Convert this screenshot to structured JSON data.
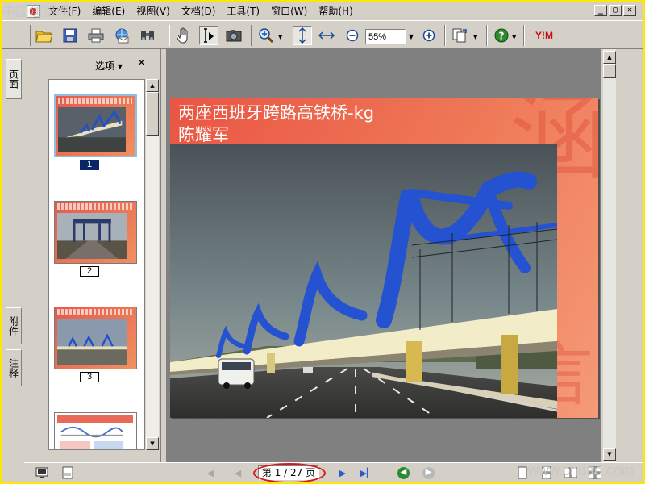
{
  "menu": {
    "items": [
      "文件(F)",
      "编辑(E)",
      "视图(V)",
      "文档(D)",
      "工具(T)",
      "窗口(W)",
      "帮助(H)"
    ]
  },
  "window_controls": [
    "_",
    "▢",
    "✕"
  ],
  "toolbar": {
    "zoom_value": "55%",
    "brand_label": "Y!M"
  },
  "left_tabs": {
    "pages": "页面",
    "attachments": "附件",
    "comments": "注释"
  },
  "panel": {
    "options_label": "选项 ▾",
    "close_label": "✕",
    "thumbnails": [
      {
        "label": "1",
        "selected": true
      },
      {
        "label": "2",
        "selected": false
      },
      {
        "label": "3",
        "selected": false
      }
    ]
  },
  "slide": {
    "title_line1": "两座西班牙跨路高铁桥-kg",
    "title_line2": "陈耀军",
    "deco_top": "涵",
    "deco_bottom": "言"
  },
  "statusbar": {
    "page_indicator": "第 1 / 27 页",
    "nav_first": "◀▏",
    "nav_prev": "◀",
    "nav_next": "▶",
    "nav_last": "▶▏"
  },
  "watermarks": {
    "top_left": "中国建筑网",
    "bottom_right": "www.cndao.com"
  },
  "colors": {
    "highlight_oval": "#d81818",
    "selected_page": "#0a246a",
    "slide_red": "#ea5544"
  }
}
